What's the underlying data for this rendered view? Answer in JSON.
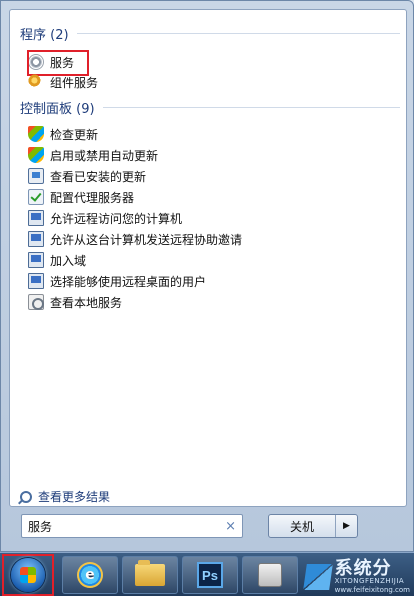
{
  "programs": {
    "title": "程序 (2)",
    "items": [
      {
        "label": "服务",
        "icon": "gear-icon"
      },
      {
        "label": "组件服务",
        "icon": "component-services-icon"
      }
    ]
  },
  "control_panel": {
    "title": "控制面板 (9)",
    "items": [
      {
        "label": "检查更新",
        "icon": "windows-update-icon"
      },
      {
        "label": "启用或禁用自动更新",
        "icon": "windows-update-icon"
      },
      {
        "label": "查看已安装的更新",
        "icon": "installed-updates-icon"
      },
      {
        "label": "配置代理服务器",
        "icon": "proxy-settings-icon"
      },
      {
        "label": "允许远程访问您的计算机",
        "icon": "remote-access-icon"
      },
      {
        "label": "允许从这台计算机发送远程协助邀请",
        "icon": "remote-access-icon"
      },
      {
        "label": "加入域",
        "icon": "remote-access-icon"
      },
      {
        "label": "选择能够使用远程桌面的用户",
        "icon": "remote-access-icon"
      },
      {
        "label": "查看本地服务",
        "icon": "local-services-icon"
      }
    ]
  },
  "see_more": "查看更多结果",
  "search": {
    "value": "服务",
    "clear": "×"
  },
  "shutdown": {
    "label": "关机",
    "arrow": "▶"
  },
  "taskbar": {
    "ps_label": "Ps",
    "ie_label": "e"
  },
  "watermark": {
    "text": "系统分",
    "sub": "XITONGFENZHIJIA",
    "url": "www.feifeixitong.com"
  }
}
